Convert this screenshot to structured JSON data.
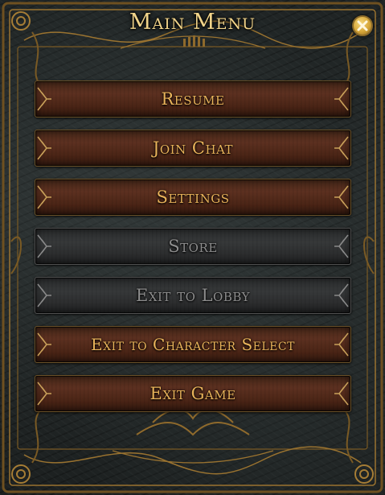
{
  "menu": {
    "title": "Main Menu",
    "close_icon": "close-x-icon"
  },
  "buttons": [
    {
      "id": "resume",
      "label": "Resume",
      "enabled": true
    },
    {
      "id": "join-chat",
      "label": "Join Chat",
      "enabled": true
    },
    {
      "id": "settings",
      "label": "Settings",
      "enabled": true
    },
    {
      "id": "store",
      "label": "Store",
      "enabled": false
    },
    {
      "id": "exit-to-lobby",
      "label": "Exit to Lobby",
      "enabled": false
    },
    {
      "id": "exit-to-character-select",
      "label": "Exit to Character Select",
      "enabled": true
    },
    {
      "id": "exit-game",
      "label": "Exit Game",
      "enabled": true
    }
  ],
  "colors": {
    "gold": "#f1d48a",
    "button_text": "#e9b35a",
    "disabled_text": "#8d8d8d",
    "frame": "#9a7330"
  }
}
